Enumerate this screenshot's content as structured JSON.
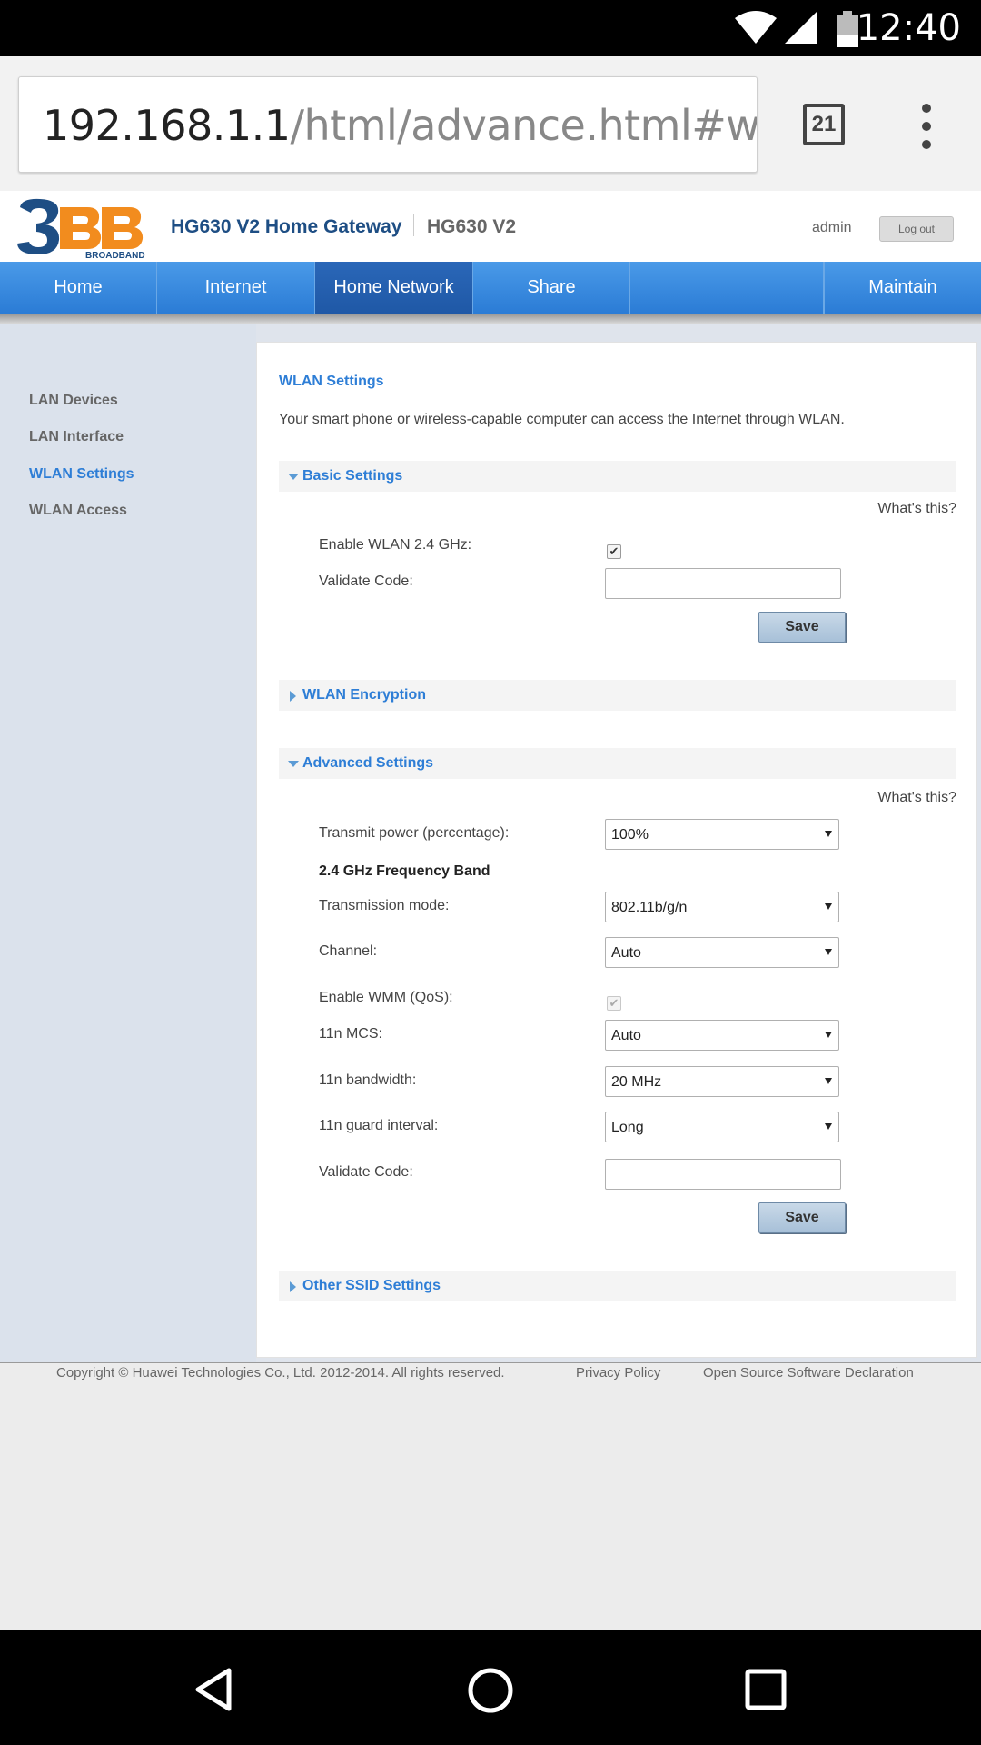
{
  "statusbar": {
    "time": "12:40",
    "icons": [
      "wifi-icon",
      "cell-signal-icon",
      "battery-icon"
    ]
  },
  "browser": {
    "url_host": "192.168.1.1",
    "url_path": "/html/advance.html#wlan",
    "tab_count": "21",
    "menu_icon": "overflow-menu-icon"
  },
  "router": {
    "logo_text": "BROADBAND",
    "product_title": "HG630 V2 Home Gateway",
    "model": "HG630 V2",
    "user": "admin",
    "logout_label": "Log out",
    "nav": [
      {
        "label": "Home"
      },
      {
        "label": "Internet"
      },
      {
        "label": "Home Network"
      },
      {
        "label": "Share"
      },
      {
        "label": ""
      },
      {
        "label": "Maintain"
      }
    ],
    "active_nav": "Home Network",
    "sidebar": [
      {
        "label": "LAN Devices"
      },
      {
        "label": "LAN Interface"
      },
      {
        "label": "WLAN Settings"
      },
      {
        "label": "WLAN Access"
      }
    ],
    "active_sidebar": "WLAN Settings"
  },
  "page": {
    "title": "WLAN Settings",
    "description": "Your smart phone or wireless-capable computer can access the Internet through WLAN.",
    "whats_this": "What's this?",
    "basic": {
      "title": "Basic Settings",
      "enable_label": "Enable WLAN 2.4 GHz:",
      "enable_checked": true,
      "validate_label": "Validate Code:",
      "validate_value": "",
      "save_label": "Save"
    },
    "encryption": {
      "title": "WLAN Encryption"
    },
    "advanced": {
      "title": "Advanced Settings",
      "transmit_label": "Transmit power (percentage):",
      "transmit_value": "100%",
      "band_heading": "2.4 GHz Frequency Band",
      "mode_label": "Transmission mode:",
      "mode_value": "802.11b/g/n",
      "channel_label": "Channel:",
      "channel_value": "Auto",
      "wmm_label": "Enable WMM (QoS):",
      "wmm_checked": true,
      "mcs_label": "11n MCS:",
      "mcs_value": "Auto",
      "bandwidth_label": "11n bandwidth:",
      "bandwidth_value": "20 MHz",
      "guard_label": "11n guard interval:",
      "guard_value": "Long",
      "validate_label": "Validate Code:",
      "validate_value": "",
      "save_label": "Save"
    },
    "ssid": {
      "title": "Other SSID Settings"
    }
  },
  "footer": {
    "copyright": "Copyright © Huawei Technologies Co., Ltd. 2012-2014. All rights reserved.",
    "privacy": "Privacy Policy",
    "oss": "Open Source Software Declaration"
  },
  "android_nav": [
    "back-icon",
    "home-icon",
    "recents-icon"
  ],
  "colors": {
    "nav_blue": "#2a7bd5",
    "link_blue": "#2e7ed6",
    "title_blue": "#1e4e84",
    "logo_orange": "#f28c1e"
  }
}
